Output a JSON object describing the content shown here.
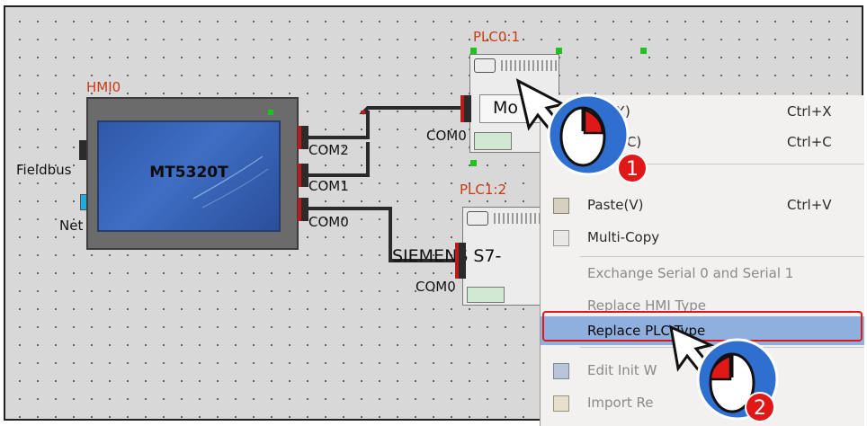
{
  "hmi": {
    "label": "HMI0",
    "model": "MT5320T",
    "fieldbus_label": "Fieldbus",
    "net_label": "Net",
    "ports": [
      "COM2",
      "COM1",
      "COM0"
    ]
  },
  "plc0": {
    "label": "PLC0:1",
    "name": "Mo",
    "port": "COM0"
  },
  "plc1": {
    "label": "PLC1:2",
    "name": "SIEMENS S7-",
    "port": "COM0"
  },
  "context_menu": {
    "items": [
      {
        "label": "Cut(X)",
        "shortcut": "Ctrl+X",
        "icon": "cut-icon"
      },
      {
        "label": "Copy(C)",
        "shortcut": "Ctrl+C",
        "icon": "copy-icon"
      },
      {
        "label": "Paste(V)",
        "shortcut": "Ctrl+V",
        "icon": "paste-icon"
      },
      {
        "label": "Multi-Copy",
        "shortcut": "",
        "icon": "multi-copy-icon"
      },
      {
        "label": "Exchange Serial 0 and Serial 1",
        "shortcut": "",
        "icon": ""
      },
      {
        "label": "Replace HMI Type",
        "shortcut": "",
        "icon": ""
      },
      {
        "label": "Replace PLC Type",
        "shortcut": "",
        "icon": ""
      },
      {
        "label": "Edit Init W",
        "shortcut": "",
        "icon": "edit-init-icon"
      },
      {
        "label": "Import Re",
        "shortcut": "",
        "icon": "import-icon"
      }
    ]
  },
  "annotations": {
    "step1": "1",
    "step2": "2"
  },
  "colors": {
    "accent_red": "#e01818",
    "highlight": "#8fb0de",
    "connection_green": "#1fc21f"
  }
}
